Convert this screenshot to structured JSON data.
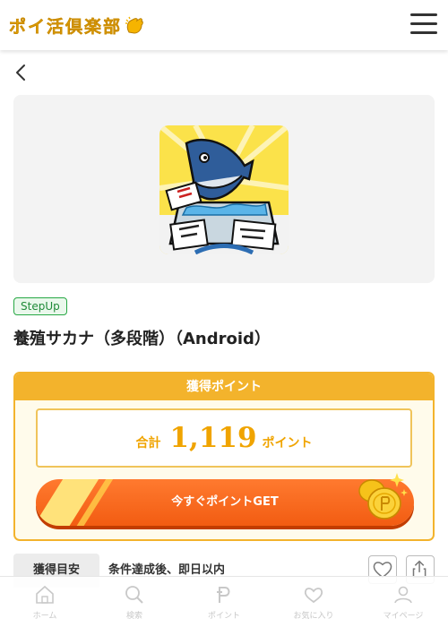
{
  "header": {
    "logo_text": "ポイ活倶楽部",
    "logo_icon": "hand-wave-icon",
    "menu_icon": "hamburger-menu-icon"
  },
  "navigation": {
    "back_icon": "chevron-left-icon"
  },
  "offer": {
    "tag": "StepUp",
    "title": "養殖サカナ（多段階）（Android）"
  },
  "points": {
    "header": "獲得ポイント",
    "total_label": "合計",
    "total_value": "1,119",
    "total_unit": "ポイント",
    "cta_label": "今すぐポイントGET"
  },
  "info": {
    "label": "獲得目安",
    "value": "条件達成後、即日以内"
  },
  "bottom_nav": {
    "items": [
      {
        "label": "ホーム",
        "icon": "home-icon"
      },
      {
        "label": "検索",
        "icon": "search-icon"
      },
      {
        "label": "ポイント",
        "icon": "point-icon"
      },
      {
        "label": "お気に入り",
        "icon": "heart-icon"
      },
      {
        "label": "マイページ",
        "icon": "user-icon"
      }
    ]
  },
  "colors": {
    "brand_yellow": "#f6b400",
    "points_gold": "#f3b32c",
    "cta_orange": "#f25c12",
    "tag_green": "#27a844"
  }
}
